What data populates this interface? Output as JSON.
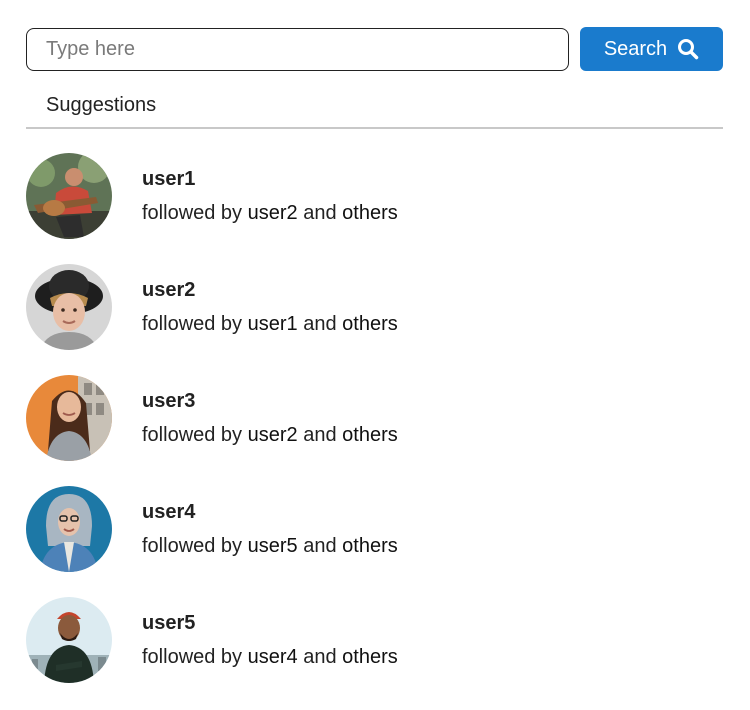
{
  "search": {
    "placeholder": "Type here",
    "button_label": "Search",
    "button_icon": "search-icon"
  },
  "suggestions": {
    "heading": "Suggestions",
    "users": [
      {
        "username": "user1",
        "followed_prefix": "followed by",
        "followed_by": "user2",
        "connector": "and",
        "others": "others",
        "avatar_icon": "avatar-guitar-player"
      },
      {
        "username": "user2",
        "followed_prefix": "followed by",
        "followed_by": "user1",
        "connector": "and",
        "others": "others",
        "avatar_icon": "avatar-hat-man"
      },
      {
        "username": "user3",
        "followed_prefix": "followed by",
        "followed_by": "user2",
        "connector": "and",
        "others": "others",
        "avatar_icon": "avatar-smiling-woman"
      },
      {
        "username": "user4",
        "followed_prefix": "followed by",
        "followed_by": "user5",
        "connector": "and",
        "others": "others",
        "avatar_icon": "avatar-hooded-woman"
      },
      {
        "username": "user5",
        "followed_prefix": "followed by",
        "followed_by": "user4",
        "connector": "and",
        "others": "others",
        "avatar_icon": "avatar-beanie-man"
      }
    ]
  },
  "colors": {
    "accent": "#1a7bcd",
    "divider": "#c8c8c8",
    "text": "#222222"
  }
}
